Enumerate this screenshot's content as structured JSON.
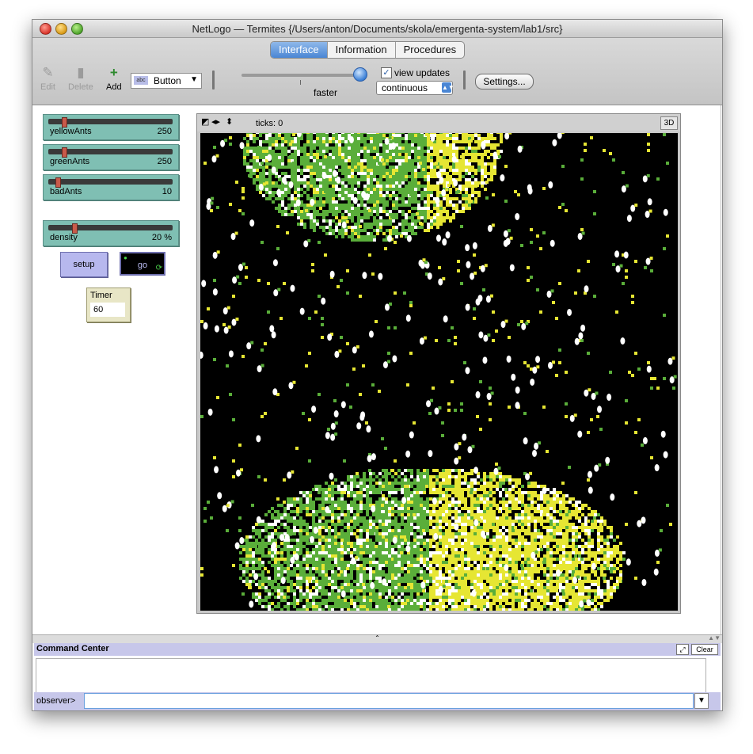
{
  "window": {
    "title": "NetLogo — Termites {/Users/anton/Documents/skola/emergenta-system/lab1/src}"
  },
  "tabs": [
    {
      "label": "Interface",
      "active": true
    },
    {
      "label": "Information",
      "active": false
    },
    {
      "label": "Procedures",
      "active": false
    }
  ],
  "toolbar": {
    "edit_label": "Edit",
    "delete_label": "Delete",
    "add_label": "Add",
    "widget_type": "Button",
    "speed_label": "faster",
    "speed_fraction": 0.97,
    "view_updates_label": "view updates",
    "view_updates_checked": true,
    "update_mode": "continuous",
    "settings_label": "Settings..."
  },
  "sliders": [
    {
      "name": "yellowAnts",
      "value": "250",
      "fraction": 0.11
    },
    {
      "name": "greenAnts",
      "value": "250",
      "fraction": 0.11
    },
    {
      "name": "badAnts",
      "value": "10",
      "fraction": 0.06
    },
    {
      "name": "density",
      "value": "20 %",
      "fraction": 0.2
    }
  ],
  "buttons": {
    "setup_label": "setup",
    "go_label": "go"
  },
  "timer": {
    "label": "Timer",
    "value": "60"
  },
  "view": {
    "ticks_label": "ticks: 0",
    "three_d_label": "3D"
  },
  "command_center": {
    "title": "Command Center",
    "clear_label": "Clear",
    "prompt_label": "observer>"
  },
  "colors": {
    "green_chip": "#5aae3a",
    "yellow_chip": "#e6e633",
    "ant": "#ffffff",
    "world_bg": "#000000",
    "slider_widget": "#7fbfb3",
    "button_widget": "#b7b8ee",
    "input_widget": "#e8e6c6",
    "command_bar": "#c7c7ea"
  }
}
